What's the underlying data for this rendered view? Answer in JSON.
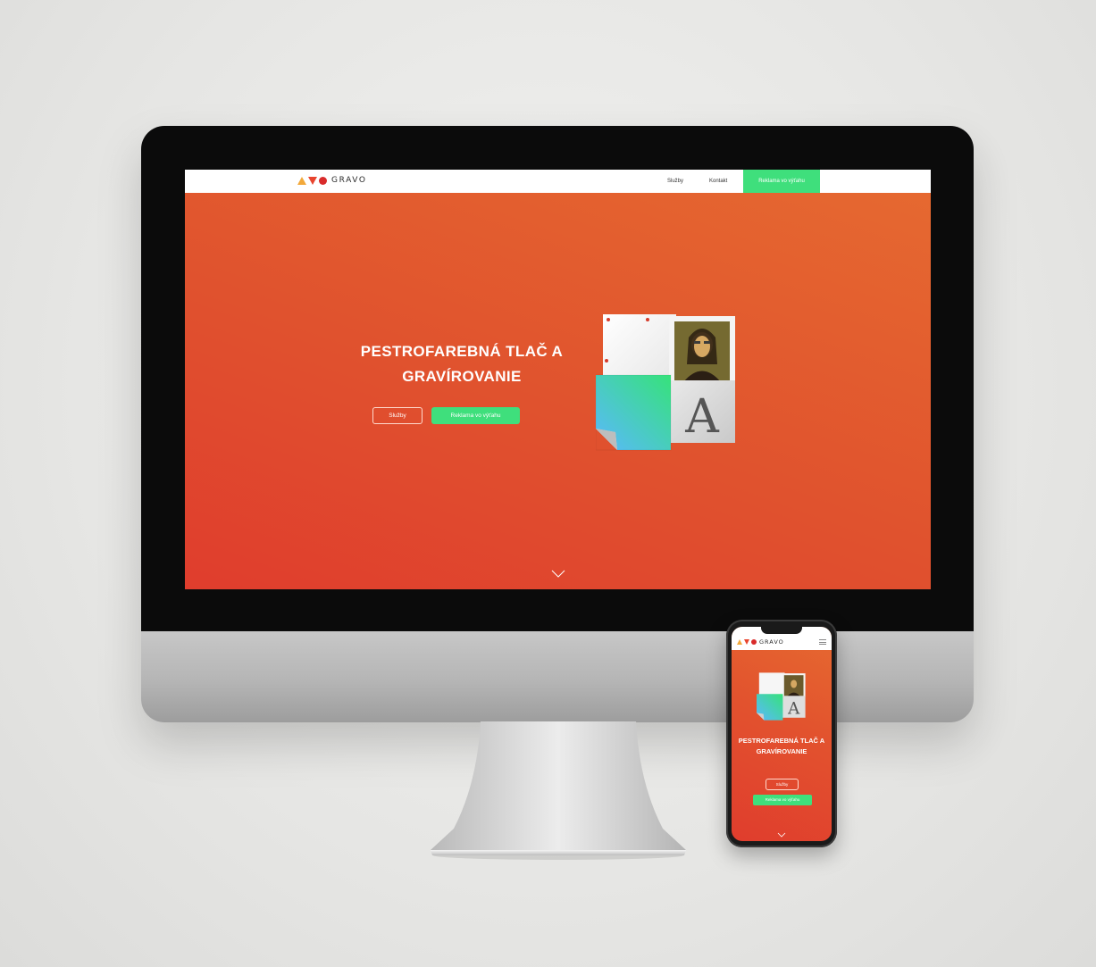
{
  "brand": {
    "name": "GRAVO"
  },
  "nav": {
    "services_label": "Služby",
    "contact_label": "Kontakt",
    "cta_label": "Reklama vo výťahu"
  },
  "hero": {
    "title": "PESTROFAREBNÁ TLAČ A GRAVÍROVANIE",
    "primary_button": "Služby",
    "secondary_button": "Reklama vo výťahu",
    "illustration_letter": "A"
  },
  "mobile": {
    "title": "PESTROFAREBNÁ TLAČ A GRAVÍROVANIE",
    "primary_button": "Služby",
    "secondary_button": "Reklama vo výťahu",
    "illustration_letter": "A"
  },
  "icons": [
    "logo-triangle-up-icon",
    "logo-triangle-down-icon",
    "logo-circle-icon",
    "chevron-down-icon",
    "hamburger-menu-icon"
  ],
  "colors": {
    "accent_green": "#3fdf7c",
    "hero_start": "#e03d2d",
    "hero_end": "#e66a30",
    "logo_orange": "#f2a93b",
    "logo_red": "#e8452e"
  }
}
